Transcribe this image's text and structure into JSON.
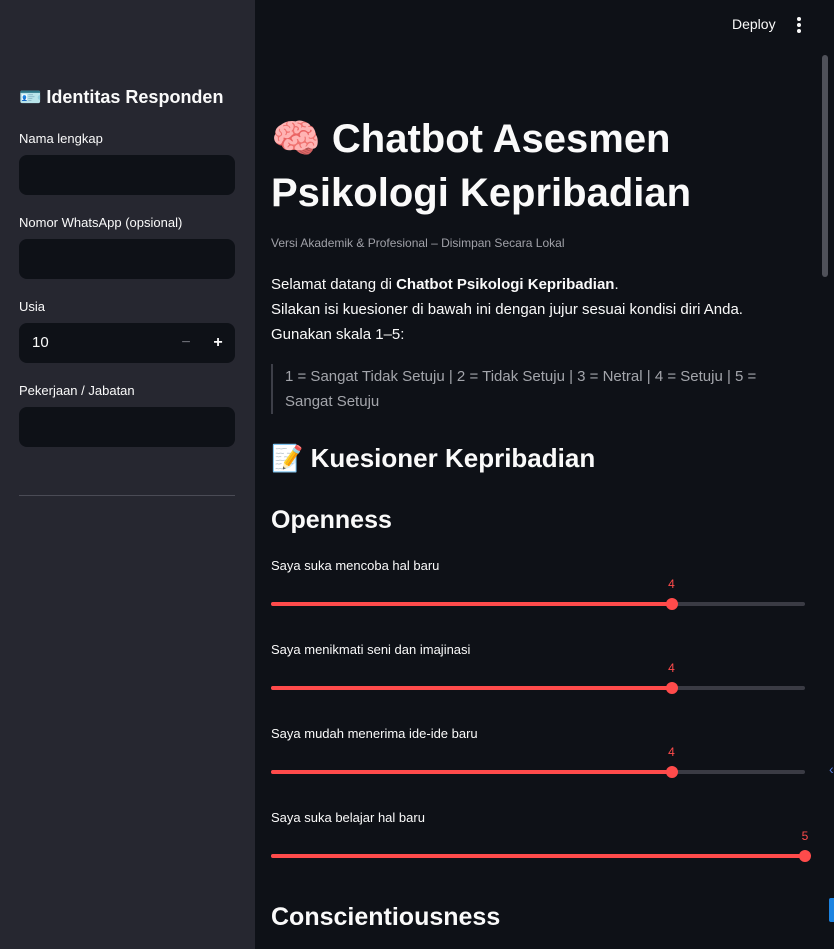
{
  "sidebar": {
    "header": "🪪 Identitas Responden",
    "fields": {
      "name_label": "Nama lengkap",
      "phone_label": "Nomor WhatsApp (opsional)",
      "age_label": "Usia",
      "age_value": "10",
      "job_label": "Pekerjaan / Jabatan"
    },
    "stepper": {
      "minus": "−",
      "plus": "+"
    }
  },
  "toolbar": {
    "deploy_label": "Deploy",
    "menu_icon": "kebab-menu-icon"
  },
  "main": {
    "title": "🧠 Chatbot Asesmen Psikologi Kepribadian",
    "caption": "Versi Akademik & Profesional – Disimpan Secara Lokal",
    "intro": {
      "welcome_prefix": "Selamat datang di ",
      "welcome_bold": "Chatbot Psikologi Kepribadian",
      "welcome_suffix": ".",
      "line2": "Silakan isi kuesioner di bawah ini dengan jujur sesuai kondisi diri Anda.",
      "line3": "Gunakan skala 1–5:"
    },
    "scale_note": "1 = Sangat Tidak Setuju | 2 = Tidak Setuju | 3 = Netral | 4 = Setuju | 5 = Sangat Setuju",
    "section_heading": "📝 Kuesioner Kepribadian",
    "openness_heading": "Openness",
    "conscientiousness_heading": "Conscientiousness",
    "slider_range": [
      1,
      5
    ],
    "sliders": [
      {
        "label": "Saya suka mencoba hal baru",
        "value": 4
      },
      {
        "label": "Saya menikmati seni dan imajinasi",
        "value": 4
      },
      {
        "label": "Saya mudah menerima ide-ide baru",
        "value": 4
      },
      {
        "label": "Saya suka belajar hal baru",
        "value": 5
      }
    ]
  },
  "colors": {
    "accent": "#ff4b4b",
    "sidebar_bg": "#262730",
    "main_bg": "#0e1117"
  }
}
